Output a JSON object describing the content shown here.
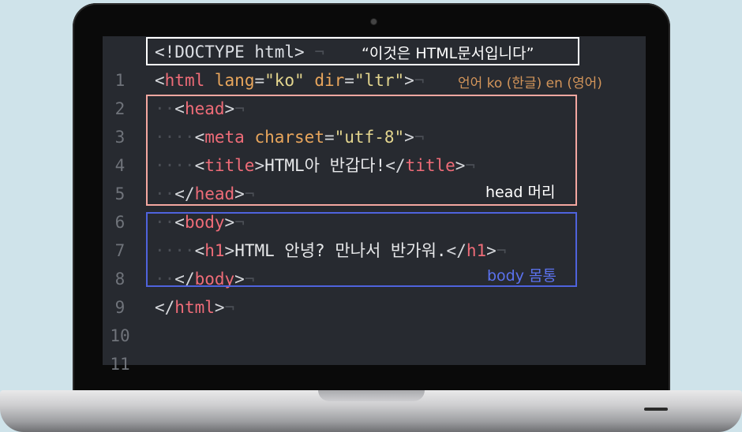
{
  "editor": {
    "line_numbers": [
      "1",
      "2",
      "3",
      "4",
      "5",
      "6",
      "7",
      "8",
      "9",
      "10",
      "11"
    ],
    "doctype": "<!DOCTYPE html>",
    "html_open": {
      "lt": "<",
      "tag": "html",
      "attr1": "lang",
      "val1": "\"ko\"",
      "attr2": "dir",
      "val2": "\"ltr\"",
      "gt": ">"
    },
    "head_open": {
      "lt": "<",
      "tag": "head",
      "gt": ">"
    },
    "meta": {
      "lt": "<",
      "tag": "meta",
      "attr": "charset",
      "val": "\"utf-8\"",
      "gt": ">"
    },
    "title": {
      "lt": "<",
      "tag": "title",
      "gt": ">",
      "text": "HTML아 반갑다!",
      "close_lt": "</",
      "close_tag": "title",
      "close_gt": ">"
    },
    "head_close": {
      "lt": "</",
      "tag": "head",
      "gt": ">"
    },
    "body_open": {
      "lt": "<",
      "tag": "body",
      "gt": ">"
    },
    "h1": {
      "lt": "<",
      "tag": "h1",
      "gt": ">",
      "text": "HTML 안녕? 만나서 반가워.",
      "close_lt": "</",
      "close_tag": "h1",
      "close_gt": ">"
    },
    "body_close": {
      "lt": "</",
      "tag": "body",
      "gt": ">"
    },
    "html_close": {
      "lt": "</",
      "tag": "html",
      "gt": ">"
    },
    "eol_mark": "¬"
  },
  "annotations": {
    "doctype_note": "“이것은 HTML문서입니다”",
    "lang_note": "언어 ko (한글) en (영어)",
    "head_note": "head 머리",
    "body_note": "body 몸통"
  },
  "colors": {
    "background": "#cfe3ea",
    "editor_bg": "#272a30",
    "tag": "#ef6c78",
    "attribute": "#e9a65c",
    "string": "#e3d58e",
    "head_box": "#f4a7a0",
    "body_box": "#4f63dd",
    "lang_note": "#d3955a"
  }
}
